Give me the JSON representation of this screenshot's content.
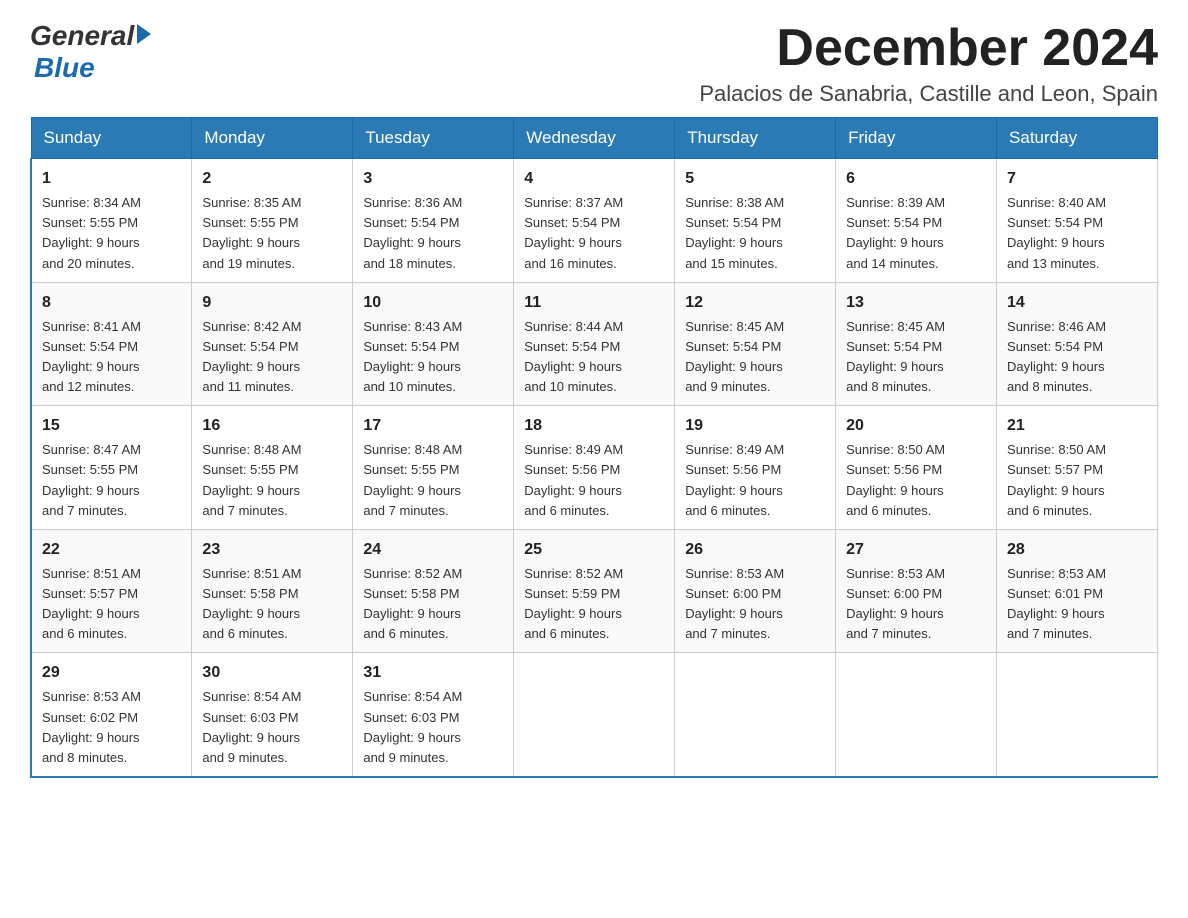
{
  "header": {
    "logo_general": "General",
    "logo_blue": "Blue",
    "month_title": "December 2024",
    "location": "Palacios de Sanabria, Castille and Leon, Spain"
  },
  "days_of_week": [
    "Sunday",
    "Monday",
    "Tuesday",
    "Wednesday",
    "Thursday",
    "Friday",
    "Saturday"
  ],
  "weeks": [
    [
      {
        "day": "1",
        "sunrise": "8:34 AM",
        "sunset": "5:55 PM",
        "daylight": "9 hours and 20 minutes."
      },
      {
        "day": "2",
        "sunrise": "8:35 AM",
        "sunset": "5:55 PM",
        "daylight": "9 hours and 19 minutes."
      },
      {
        "day": "3",
        "sunrise": "8:36 AM",
        "sunset": "5:54 PM",
        "daylight": "9 hours and 18 minutes."
      },
      {
        "day": "4",
        "sunrise": "8:37 AM",
        "sunset": "5:54 PM",
        "daylight": "9 hours and 16 minutes."
      },
      {
        "day": "5",
        "sunrise": "8:38 AM",
        "sunset": "5:54 PM",
        "daylight": "9 hours and 15 minutes."
      },
      {
        "day": "6",
        "sunrise": "8:39 AM",
        "sunset": "5:54 PM",
        "daylight": "9 hours and 14 minutes."
      },
      {
        "day": "7",
        "sunrise": "8:40 AM",
        "sunset": "5:54 PM",
        "daylight": "9 hours and 13 minutes."
      }
    ],
    [
      {
        "day": "8",
        "sunrise": "8:41 AM",
        "sunset": "5:54 PM",
        "daylight": "9 hours and 12 minutes."
      },
      {
        "day": "9",
        "sunrise": "8:42 AM",
        "sunset": "5:54 PM",
        "daylight": "9 hours and 11 minutes."
      },
      {
        "day": "10",
        "sunrise": "8:43 AM",
        "sunset": "5:54 PM",
        "daylight": "9 hours and 10 minutes."
      },
      {
        "day": "11",
        "sunrise": "8:44 AM",
        "sunset": "5:54 PM",
        "daylight": "9 hours and 10 minutes."
      },
      {
        "day": "12",
        "sunrise": "8:45 AM",
        "sunset": "5:54 PM",
        "daylight": "9 hours and 9 minutes."
      },
      {
        "day": "13",
        "sunrise": "8:45 AM",
        "sunset": "5:54 PM",
        "daylight": "9 hours and 8 minutes."
      },
      {
        "day": "14",
        "sunrise": "8:46 AM",
        "sunset": "5:54 PM",
        "daylight": "9 hours and 8 minutes."
      }
    ],
    [
      {
        "day": "15",
        "sunrise": "8:47 AM",
        "sunset": "5:55 PM",
        "daylight": "9 hours and 7 minutes."
      },
      {
        "day": "16",
        "sunrise": "8:48 AM",
        "sunset": "5:55 PM",
        "daylight": "9 hours and 7 minutes."
      },
      {
        "day": "17",
        "sunrise": "8:48 AM",
        "sunset": "5:55 PM",
        "daylight": "9 hours and 7 minutes."
      },
      {
        "day": "18",
        "sunrise": "8:49 AM",
        "sunset": "5:56 PM",
        "daylight": "9 hours and 6 minutes."
      },
      {
        "day": "19",
        "sunrise": "8:49 AM",
        "sunset": "5:56 PM",
        "daylight": "9 hours and 6 minutes."
      },
      {
        "day": "20",
        "sunrise": "8:50 AM",
        "sunset": "5:56 PM",
        "daylight": "9 hours and 6 minutes."
      },
      {
        "day": "21",
        "sunrise": "8:50 AM",
        "sunset": "5:57 PM",
        "daylight": "9 hours and 6 minutes."
      }
    ],
    [
      {
        "day": "22",
        "sunrise": "8:51 AM",
        "sunset": "5:57 PM",
        "daylight": "9 hours and 6 minutes."
      },
      {
        "day": "23",
        "sunrise": "8:51 AM",
        "sunset": "5:58 PM",
        "daylight": "9 hours and 6 minutes."
      },
      {
        "day": "24",
        "sunrise": "8:52 AM",
        "sunset": "5:58 PM",
        "daylight": "9 hours and 6 minutes."
      },
      {
        "day": "25",
        "sunrise": "8:52 AM",
        "sunset": "5:59 PM",
        "daylight": "9 hours and 6 minutes."
      },
      {
        "day": "26",
        "sunrise": "8:53 AM",
        "sunset": "6:00 PM",
        "daylight": "9 hours and 7 minutes."
      },
      {
        "day": "27",
        "sunrise": "8:53 AM",
        "sunset": "6:00 PM",
        "daylight": "9 hours and 7 minutes."
      },
      {
        "day": "28",
        "sunrise": "8:53 AM",
        "sunset": "6:01 PM",
        "daylight": "9 hours and 7 minutes."
      }
    ],
    [
      {
        "day": "29",
        "sunrise": "8:53 AM",
        "sunset": "6:02 PM",
        "daylight": "9 hours and 8 minutes."
      },
      {
        "day": "30",
        "sunrise": "8:54 AM",
        "sunset": "6:03 PM",
        "daylight": "9 hours and 9 minutes."
      },
      {
        "day": "31",
        "sunrise": "8:54 AM",
        "sunset": "6:03 PM",
        "daylight": "9 hours and 9 minutes."
      },
      null,
      null,
      null,
      null
    ]
  ],
  "labels": {
    "sunrise": "Sunrise:",
    "sunset": "Sunset:",
    "daylight": "Daylight:"
  }
}
